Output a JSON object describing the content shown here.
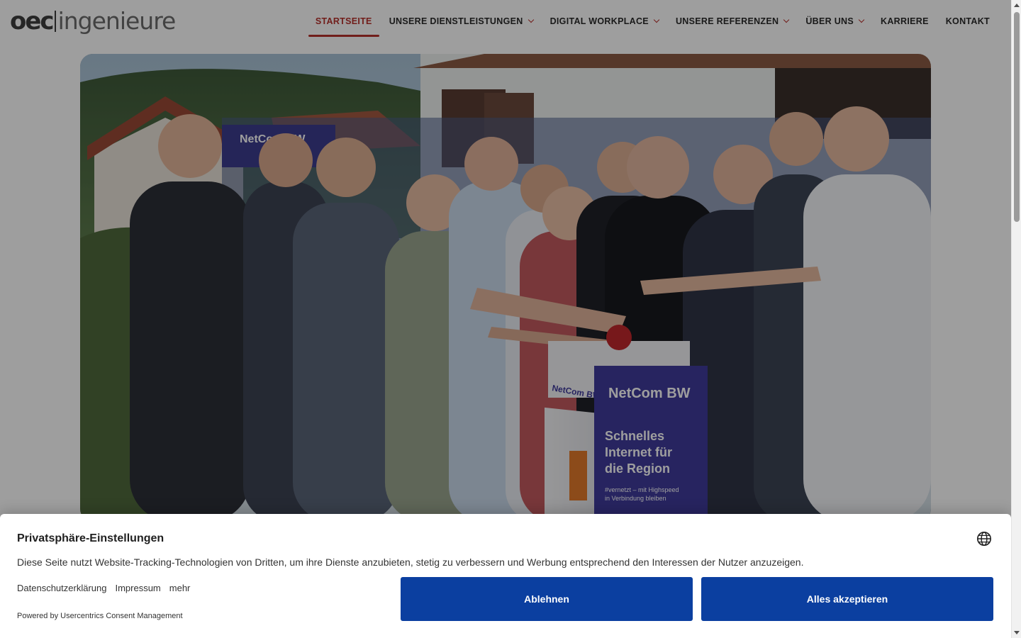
{
  "logo": {
    "mark": "oec",
    "word": "ingenieure"
  },
  "nav": {
    "items": [
      {
        "label": "STARTSEITE",
        "active": true,
        "dropdown": false
      },
      {
        "label": "UNSERE DIENSTLEISTUNGEN",
        "active": false,
        "dropdown": true
      },
      {
        "label": "DIGITAL WORKPLACE",
        "active": false,
        "dropdown": true
      },
      {
        "label": "UNSERE REFERENZEN",
        "active": false,
        "dropdown": true
      },
      {
        "label": "ÜBER UNS",
        "active": false,
        "dropdown": true
      },
      {
        "label": "KARRIERE",
        "active": false,
        "dropdown": false
      },
      {
        "label": "KONTAKT",
        "active": false,
        "dropdown": false
      }
    ],
    "accent_color": "#b7312c"
  },
  "hero": {
    "image": "group-photo-broadband-launch",
    "banner_brand": "NetCom BW",
    "podium_brand": "NetCom BW",
    "podium_side_brand": "NetCom BW",
    "podium_headline": [
      "Schnelles",
      "Internet für",
      "die Region"
    ],
    "podium_tagline": [
      "#vernetzt – mit Highspeed",
      "in Verbindung bleiben"
    ]
  },
  "consent": {
    "title": "Privatsphäre-Einstellungen",
    "text": "Diese Seite nutzt Website-Tracking-Technologien von Dritten, um ihre Dienste anzubieten, stetig zu verbessern und Werbung entsprechend den Interessen der Nutzer anzuzeigen.",
    "links": [
      "Datenschutzerklärung",
      "Impressum",
      "mehr"
    ],
    "powered_by": "Powered by Usercentrics Consent Management",
    "decline_label": "Ablehnen",
    "accept_label": "Alles akzeptieren",
    "button_color": "#0b3fa0",
    "language_icon": "globe-icon"
  }
}
